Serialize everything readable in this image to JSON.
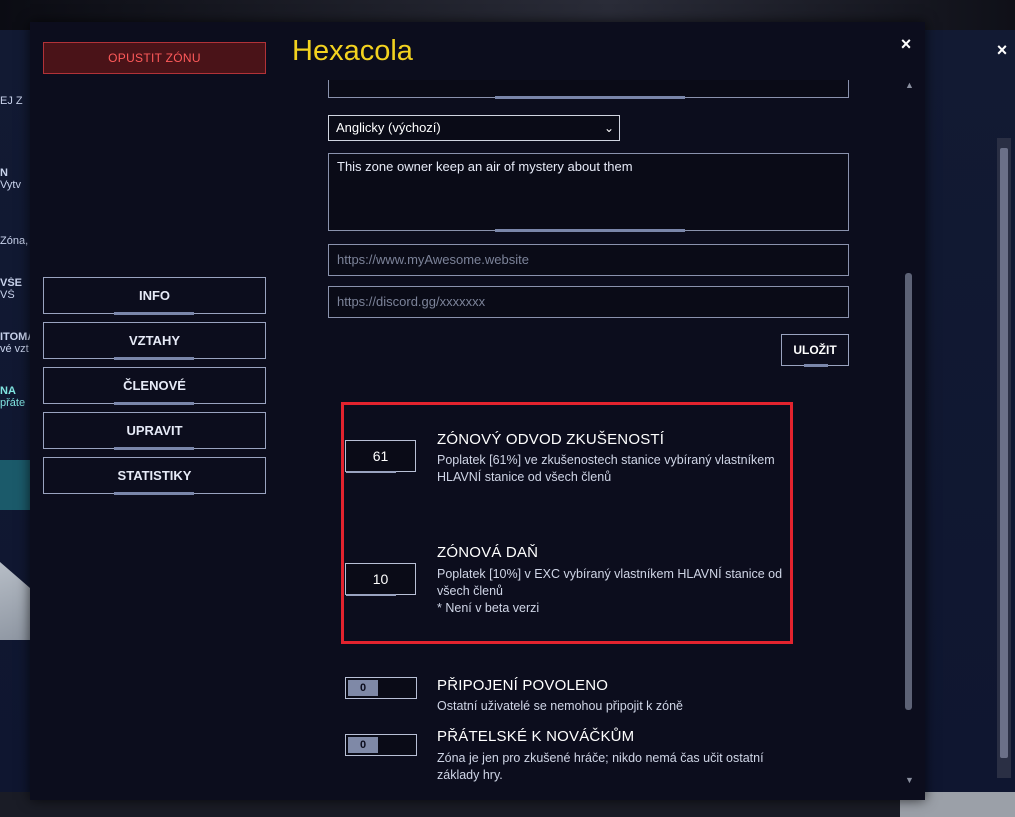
{
  "background": {
    "left_fragments": [
      "EJ Z",
      "N",
      "Vytv",
      "Zóna,",
      "VŠE",
      "VŠ",
      "ITOMA",
      "vé vzt",
      "NA",
      "přáte"
    ],
    "close_glyph": "×"
  },
  "dialog": {
    "leave_button": "OPUSTIT ZÓNU",
    "title": "Hexacola",
    "close_glyph": "×",
    "nav": [
      "INFO",
      "VZTAHY",
      "ČLENOVÉ",
      "UPRAVIT",
      "STATISTIKY"
    ]
  },
  "form": {
    "language_selected": "Anglicky (výchozí)",
    "description": "This zone owner keep an air of mystery about them",
    "website_placeholder": "https://www.myAwesome.website",
    "discord_placeholder": "https://discord.gg/xxxxxxx",
    "save_label": "ULOŽIT"
  },
  "settings": {
    "xp_tax": {
      "value": "61",
      "title": "ZÓNOVÝ ODVOD ZKUŠENOSTÍ",
      "desc_line1": "Poplatek [61%] ve zkušenostech stanice vybíraný vlastníkem",
      "desc_line2": "HLAVNÍ stanice od všech členů"
    },
    "zone_tax": {
      "value": "10",
      "title": "ZÓNOVÁ DAŇ",
      "desc_line1": "Poplatek [10%] v EXC vybíraný vlastníkem HLAVNÍ stanice od",
      "desc_line2": "všech členů",
      "note": "* Není v beta verzi"
    },
    "join_allowed": {
      "toggle_value": "0",
      "title": "PŘIPOJENÍ POVOLENO",
      "desc": "Ostatní uživatelé se nemohou připojit k zóně"
    },
    "newbie_friendly": {
      "toggle_value": "0",
      "title": "PŘÁTELSKÉ K NOVÁČKŮM",
      "desc_line1": "Zóna je jen pro zkušené hráče; nikdo nemá čas učit ostatní",
      "desc_line2": "základy hry."
    }
  },
  "colors": {
    "title": "#f3d21f",
    "danger": "#e3232e"
  }
}
